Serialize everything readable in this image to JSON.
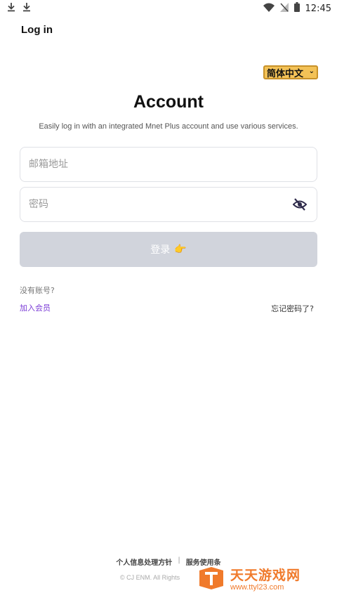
{
  "status_bar": {
    "time": "12:45",
    "left_icons": [
      "download-icon",
      "download-icon"
    ],
    "right_icons": [
      "wifi-icon",
      "no-signal-icon",
      "battery-icon"
    ]
  },
  "appbar": {
    "title": "Log in"
  },
  "language": {
    "selected": "简体中文"
  },
  "header": {
    "title": "Account",
    "subtitle": "Easily log in with an integrated Mnet Plus account and use various services."
  },
  "form": {
    "email_placeholder": "邮箱地址",
    "password_placeholder": "密码",
    "login_label": "登录",
    "login_emoji": "👉"
  },
  "links": {
    "no_account": "没有账号?",
    "join": "加入会员",
    "forgot": "忘记密码了?"
  },
  "footer": {
    "privacy": "个人信息处理方针",
    "separator": "|",
    "terms": "服务使用条",
    "copyright": "© CJ ENM. All Rights"
  },
  "watermark": {
    "name": "天天游戏网",
    "url": "www.ttyl23.com"
  },
  "colors": {
    "accent_purple": "#7a3bd6",
    "button_disabled": "#d1d4dc",
    "language_bg": "#f3c257",
    "watermark": "#f07a2b"
  }
}
